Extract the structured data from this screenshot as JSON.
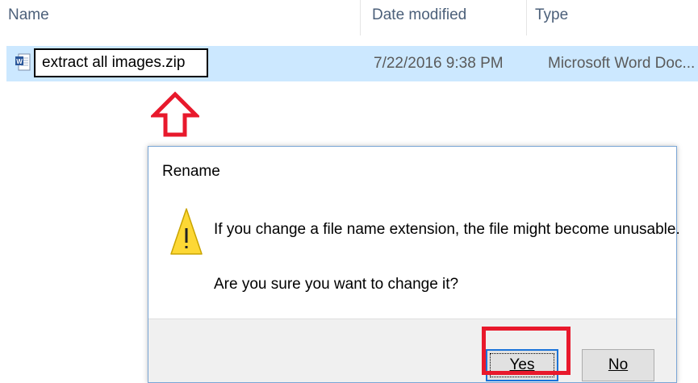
{
  "columns": {
    "name": "Name",
    "date_modified": "Date modified",
    "type": "Type"
  },
  "file": {
    "icon": "word-document-icon",
    "name": "extract all images.zip",
    "date_modified": "7/22/2016 9:38 PM",
    "type": "Microsoft Word Doc..."
  },
  "annotation": {
    "arrow_icon": "red-up-arrow-icon",
    "arrow_color": "#e8192c",
    "highlight_color": "#e8192c"
  },
  "dialog": {
    "title": "Rename",
    "icon": "warning-icon",
    "message": "If you change a file name extension, the file might become unusable.",
    "question": "Are you sure you want to change it?",
    "yes_label": "Yes",
    "no_label": "No"
  },
  "colors": {
    "selection": "#cce8ff",
    "header_text": "#4c607a",
    "warning_yellow": "#fdd835"
  }
}
